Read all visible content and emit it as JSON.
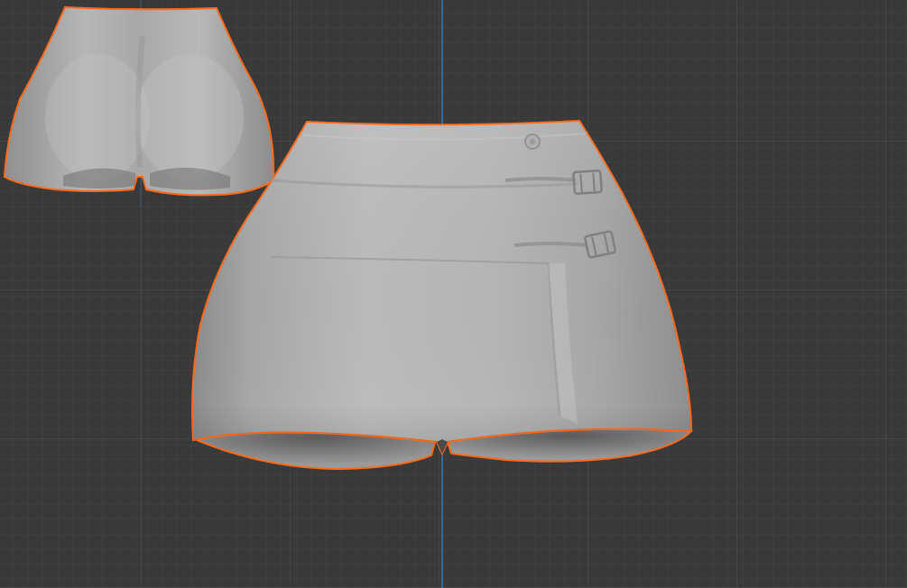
{
  "viewport": {
    "background_color": "#393939",
    "grid_minor_color": "#444444",
    "grid_major_color": "#4d4d4d",
    "y_axis_color": "#2f7fbf",
    "selection_outline_color": "#ff6a1a",
    "mesh_color": "#b4b4b4"
  },
  "objects": [
    {
      "kind": "mesh",
      "name_icon": "shorts-back-mesh",
      "selected": true
    },
    {
      "kind": "mesh",
      "name_icon": "skirt-front-mesh",
      "selected": true
    }
  ]
}
